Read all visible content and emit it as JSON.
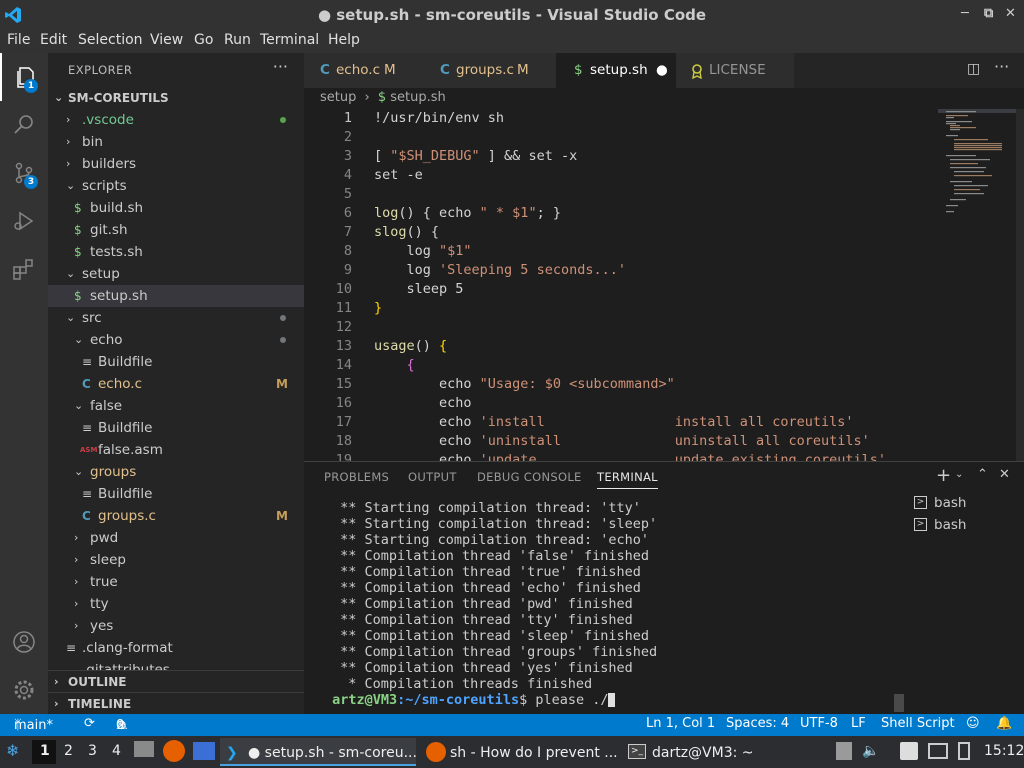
{
  "window": {
    "title": "● setup.sh - sm-coreutils - Visual Studio Code"
  },
  "menu": [
    "File",
    "Edit",
    "Selection",
    "View",
    "Go",
    "Run",
    "Terminal",
    "Help"
  ],
  "activity": {
    "explorer_badge": "1",
    "scm_badge": "3"
  },
  "sidebar": {
    "header": "EXPLORER",
    "more": "···",
    "project": "SM-COREUTILS",
    "items": [
      ".vscode",
      "bin",
      "builders",
      "scripts",
      "build.sh",
      "git.sh",
      "tests.sh",
      "setup",
      "setup.sh",
      "src",
      "echo",
      "Buildfile",
      "echo.c",
      "false",
      "Buildfile",
      "false.asm",
      "groups",
      "Buildfile",
      "groups.c",
      "pwd",
      "sleep",
      "true",
      "tty",
      "yes",
      ".clang-format",
      ".gitattributes"
    ],
    "modified_mark": "M",
    "outline": "OUTLINE",
    "timeline": "TIMELINE"
  },
  "tabs": [
    {
      "label": "echo.c",
      "mark": "M",
      "icon": "C"
    },
    {
      "label": "groups.c",
      "mark": "M",
      "icon": "C"
    },
    {
      "label": "setup.sh",
      "mark": "●",
      "icon": "$"
    },
    {
      "label": "LICENSE",
      "mark": "",
      "icon": "license-icon"
    }
  ],
  "breadcrumb": {
    "folder": "setup",
    "sep": "›",
    "file": "setup.sh"
  },
  "code": {
    "line_numbers": [
      "1",
      "2",
      "3",
      "4",
      "5",
      "6",
      "7",
      "8",
      "9",
      "10",
      "11",
      "12",
      "13",
      "14",
      "15",
      "16",
      "17",
      "18",
      "19"
    ],
    "lines": [
      [
        [
          "!/usr/bin/env sh",
          "#d4d4d4"
        ]
      ],
      [],
      [
        [
          "[ ",
          "#d4d4d4"
        ],
        [
          "\"$SH_DEBUG\"",
          "#ce9178"
        ],
        [
          " ] && set -x",
          "#d4d4d4"
        ]
      ],
      [
        [
          "set -e",
          "#d4d4d4"
        ]
      ],
      [],
      [
        [
          "log",
          "#dcdcaa"
        ],
        [
          "() { echo ",
          "#d4d4d4"
        ],
        [
          "\" * $1\"",
          "#ce9178"
        ],
        [
          "; }",
          "#d4d4d4"
        ]
      ],
      [
        [
          "slog",
          "#dcdcaa"
        ],
        [
          "() {",
          "#d4d4d4"
        ]
      ],
      [
        [
          "    log ",
          "#d4d4d4"
        ],
        [
          "\"$1\"",
          "#ce9178"
        ]
      ],
      [
        [
          "    log ",
          "#d4d4d4"
        ],
        [
          "'Sleeping 5 seconds...'",
          "#ce9178"
        ]
      ],
      [
        [
          "    sleep 5",
          "#d4d4d4"
        ]
      ],
      [
        [
          "}",
          "#ffd700"
        ]
      ],
      [],
      [
        [
          "usage",
          "#dcdcaa"
        ],
        [
          "() ",
          "#d4d4d4"
        ],
        [
          "{",
          "#ffd700"
        ]
      ],
      [
        [
          "    ",
          "#d4d4d4"
        ],
        [
          "{",
          "#da70d6"
        ]
      ],
      [
        [
          "        echo ",
          "#d4d4d4"
        ],
        [
          "\"Usage: $0 <subcommand>\"",
          "#ce9178"
        ]
      ],
      [
        [
          "        echo",
          "#d4d4d4"
        ]
      ],
      [
        [
          "        echo ",
          "#d4d4d4"
        ],
        [
          "'install                install all coreutils'",
          "#ce9178"
        ]
      ],
      [
        [
          "        echo ",
          "#d4d4d4"
        ],
        [
          "'uninstall              uninstall all coreutils'",
          "#ce9178"
        ]
      ],
      [
        [
          "        echo ",
          "#d4d4d4"
        ],
        [
          "'update                 update existing coreutils'",
          "#ce9178"
        ]
      ]
    ]
  },
  "panel": {
    "tabs": [
      "PROBLEMS",
      "OUTPUT",
      "DEBUG CONSOLE",
      "TERMINAL"
    ],
    "terminal_lines": [
      " ** Starting compilation thread: 'tty'",
      " ** Starting compilation thread: 'sleep'",
      " ** Starting compilation thread: 'echo'",
      " ** Compilation thread 'false' finished",
      " ** Compilation thread 'true' finished",
      " ** Compilation thread 'echo' finished",
      " ** Compilation thread 'pwd' finished",
      " ** Compilation thread 'tty' finished",
      " ** Compilation thread 'sleep' finished",
      " ** Compilation thread 'groups' finished",
      " ** Compilation thread 'yes' finished",
      "  * Compilation threads finished"
    ],
    "prompt": {
      "user": "dartz@VM3",
      "path": ":~/sm-coreutils",
      "rest": "$ please ./"
    },
    "terminals": [
      "bash",
      "bash"
    ]
  },
  "status": {
    "branch": "main*",
    "errors": "0",
    "warnings": "0",
    "position": "Ln 1, Col 1",
    "spaces": "Spaces: 4",
    "encoding": "UTF-8",
    "eol": "LF",
    "language": "Shell Script"
  },
  "taskbar": {
    "workspaces": [
      "1",
      "2",
      "3",
      "4"
    ],
    "tasks": [
      "● setup.sh - sm-coreu...",
      "sh - How do I prevent ...",
      "dartz@VM3: ~"
    ],
    "clock": "15:12"
  },
  "colors": {
    "accent": "#007acc",
    "modified": "#c59f5a",
    "folder_dot": "#73777a"
  }
}
